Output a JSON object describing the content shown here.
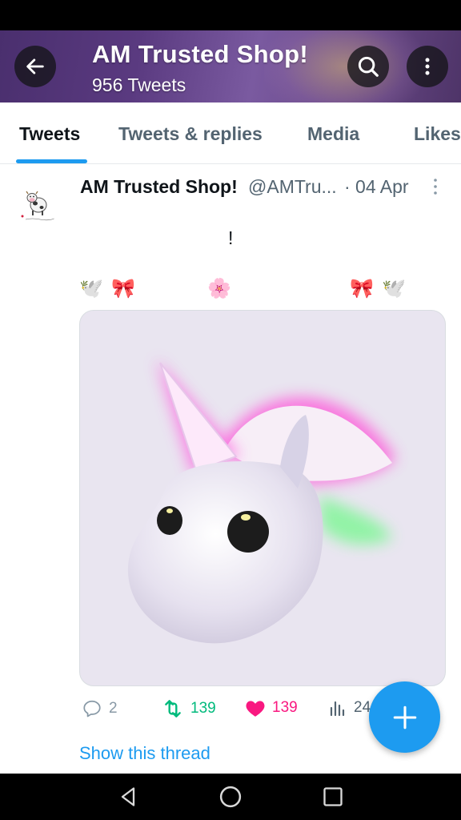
{
  "header": {
    "title": "AM Trusted Shop!",
    "subtitle": "956 Tweets",
    "back_icon": "arrow-left-icon",
    "search_icon": "search-icon",
    "more_icon": "more-vertical-icon"
  },
  "tabs": [
    {
      "label": "Tweets",
      "active": true
    },
    {
      "label": "Tweets & replies",
      "active": false
    },
    {
      "label": "Media",
      "active": false
    },
    {
      "label": "Likes",
      "active": false
    }
  ],
  "tweet": {
    "author_name": "AM Trusted Shop!",
    "handle": "@AMTru...",
    "date": "· 04 Apr",
    "text": "!",
    "emojis": [
      "🕊️",
      "🎀",
      "🌸",
      "🎀",
      "🕊️"
    ],
    "avatar_caption": "AM Trusted Shop!",
    "stats": {
      "replies": "2",
      "retweets": "139",
      "likes": "139",
      "views": "24"
    },
    "show_thread": "Show this thread"
  },
  "colors": {
    "accent": "#1d9bf0",
    "retweet": "#00ba7c",
    "like": "#f91880",
    "muted": "#536471"
  },
  "fab": {
    "icon": "plus-icon"
  },
  "nav": {
    "back_icon": "triangle-back-icon",
    "home_icon": "circle-home-icon",
    "recents_icon": "square-recents-icon"
  }
}
